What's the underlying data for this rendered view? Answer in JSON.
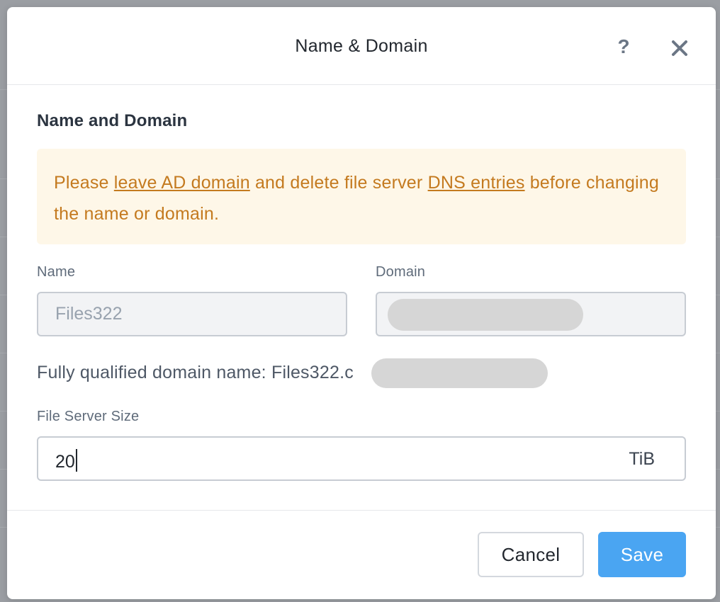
{
  "modal": {
    "title": "Name & Domain",
    "help_icon_glyph": "?",
    "section_title": "Name and Domain"
  },
  "warning": {
    "prefix": "Please ",
    "link_leave_ad": "leave AD domain",
    "middle": " and delete file server ",
    "link_dns": "DNS entries",
    "suffix": " before changing the name or domain."
  },
  "fields": {
    "name_label": "Name",
    "name_value": "Files322",
    "domain_label": "Domain",
    "domain_value": "",
    "fqdn_text": "Fully qualified domain name: Files322.c",
    "size_label": "File Server Size",
    "size_value": "20",
    "size_unit": "TiB"
  },
  "footer": {
    "cancel_label": "Cancel",
    "save_label": "Save"
  },
  "colors": {
    "accent": "#4aa5f2",
    "warning_bg": "#fef7e8",
    "warning_text": "#c47a1f"
  },
  "icons": {
    "help": "question-icon",
    "close": "close-icon"
  }
}
